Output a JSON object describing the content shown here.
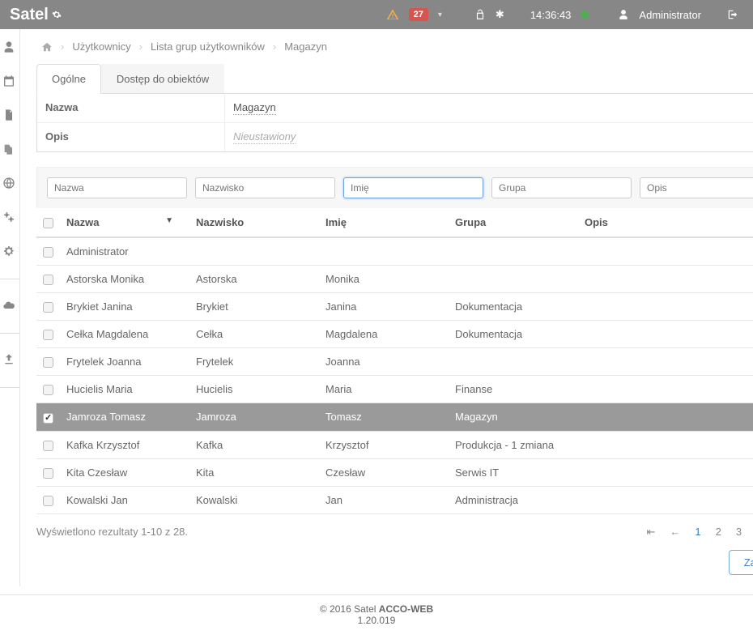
{
  "header": {
    "brand": "Satel",
    "notification_count": "27",
    "time": "14:36:43",
    "user_label": "Administrator"
  },
  "breadcrumb": {
    "items": [
      "Użytkownicy",
      "Lista grup użytkowników",
      "Magazyn"
    ]
  },
  "tabs": {
    "items": [
      {
        "label": "Ogólne",
        "active": true
      },
      {
        "label": "Dostęp do obiektów",
        "active": false
      }
    ]
  },
  "props": {
    "name_label": "Nazwa",
    "name_value": "Magazyn",
    "desc_label": "Opis",
    "desc_placeholder": "Nieustawiony"
  },
  "filters": {
    "nazwa": "Nazwa",
    "nazwisko": "Nazwisko",
    "imie": "Imię",
    "grupa": "Grupa",
    "opis": "Opis"
  },
  "columns": {
    "nazwa": "Nazwa",
    "nazwisko": "Nazwisko",
    "imie": "Imię",
    "grupa": "Grupa",
    "opis": "Opis",
    "sort_indicator": "▼"
  },
  "rows": [
    {
      "checked": false,
      "nazwa": "Administrator",
      "nazwisko": "",
      "imie": "",
      "grupa": "",
      "opis": ""
    },
    {
      "checked": false,
      "nazwa": "Astorska Monika",
      "nazwisko": "Astorska",
      "imie": "Monika",
      "grupa": "",
      "opis": ""
    },
    {
      "checked": false,
      "nazwa": "Brykiet Janina",
      "nazwisko": "Brykiet",
      "imie": "Janina",
      "grupa": "Dokumentacja",
      "opis": ""
    },
    {
      "checked": false,
      "nazwa": "Cełka Magdalena",
      "nazwisko": "Cełka",
      "imie": "Magdalena",
      "grupa": "Dokumentacja",
      "opis": ""
    },
    {
      "checked": false,
      "nazwa": "Frytelek Joanna",
      "nazwisko": "Frytelek",
      "imie": "Joanna",
      "grupa": "",
      "opis": ""
    },
    {
      "checked": false,
      "nazwa": "Hucielis Maria",
      "nazwisko": "Hucielis",
      "imie": "Maria",
      "grupa": "Finanse",
      "opis": ""
    },
    {
      "checked": true,
      "nazwa": "Jamroza Tomasz",
      "nazwisko": "Jamroza",
      "imie": "Tomasz",
      "grupa": "Magazyn",
      "opis": ""
    },
    {
      "checked": false,
      "nazwa": "Kafka Krzysztof",
      "nazwisko": "Kafka",
      "imie": "Krzysztof",
      "grupa": "Produkcja - 1 zmiana",
      "opis": ""
    },
    {
      "checked": false,
      "nazwa": "Kita Czesław",
      "nazwisko": "Kita",
      "imie": "Czesław",
      "grupa": "Serwis IT",
      "opis": ""
    },
    {
      "checked": false,
      "nazwa": "Kowalski Jan",
      "nazwisko": "Kowalski",
      "imie": "Jan",
      "grupa": "Administracja",
      "opis": ""
    }
  ],
  "results_text": "Wyświetlono rezultaty 1-10 z 28.",
  "pagination": {
    "pages": [
      "1",
      "2",
      "3"
    ],
    "current": "1"
  },
  "save_label": "Zapisz",
  "footer": {
    "copyright": "© 2016 Satel ",
    "product": "ACCO-WEB",
    "version": "1.20.019"
  }
}
